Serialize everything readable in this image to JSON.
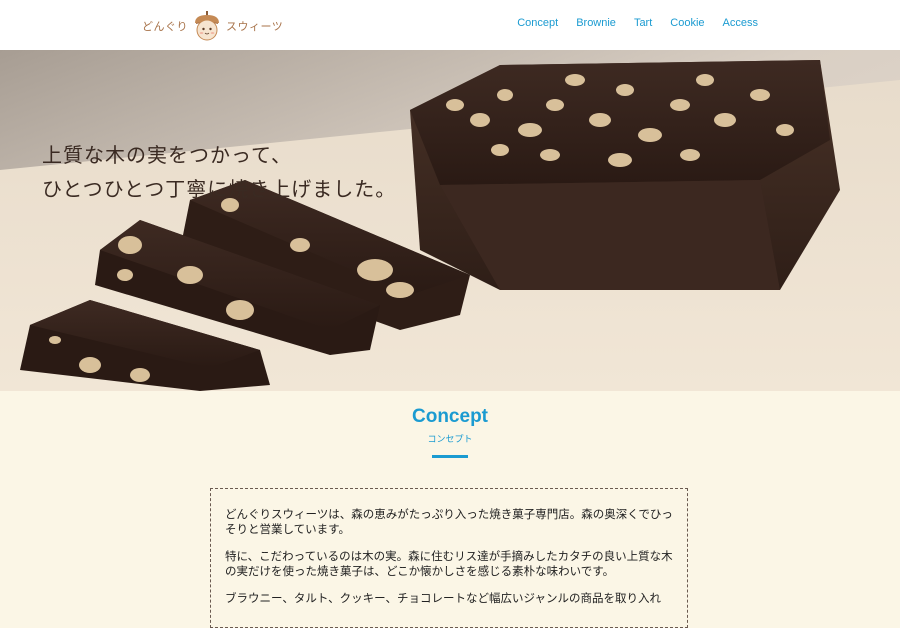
{
  "header": {
    "logo_text_left": "どんぐり",
    "logo_text_right": "スウィーツ",
    "nav": [
      {
        "label": "Concept"
      },
      {
        "label": "Brownie"
      },
      {
        "label": "Tart"
      },
      {
        "label": "Cookie"
      },
      {
        "label": "Access"
      }
    ]
  },
  "hero": {
    "line1": "上質な木の実をつかって、",
    "line2": "ひとつひとつ丁寧に焼き上げました。"
  },
  "concept": {
    "title": "Concept",
    "subtitle": "コンセプト",
    "paragraphs": [
      "どんぐりスウィーツは、森の恵みがたっぷり入った焼き菓子専門店。森の奥深くでひっそりと営業しています。",
      "特に、こだわっているのは木の実。森に住むリス達が手摘みしたカタチの良い上質な木の実だけを使った焼き菓子は、どこか懐かしさを感じる素朴な味わいです。",
      "ブラウニー、タルト、クッキー、チョコレートなど幅広いジャンルの商品を取り入れ"
    ]
  },
  "colors": {
    "accent": "#1b9bd1",
    "background": "#fbf6e6",
    "logo": "#a8734a",
    "chocolate": "#3a241c"
  }
}
